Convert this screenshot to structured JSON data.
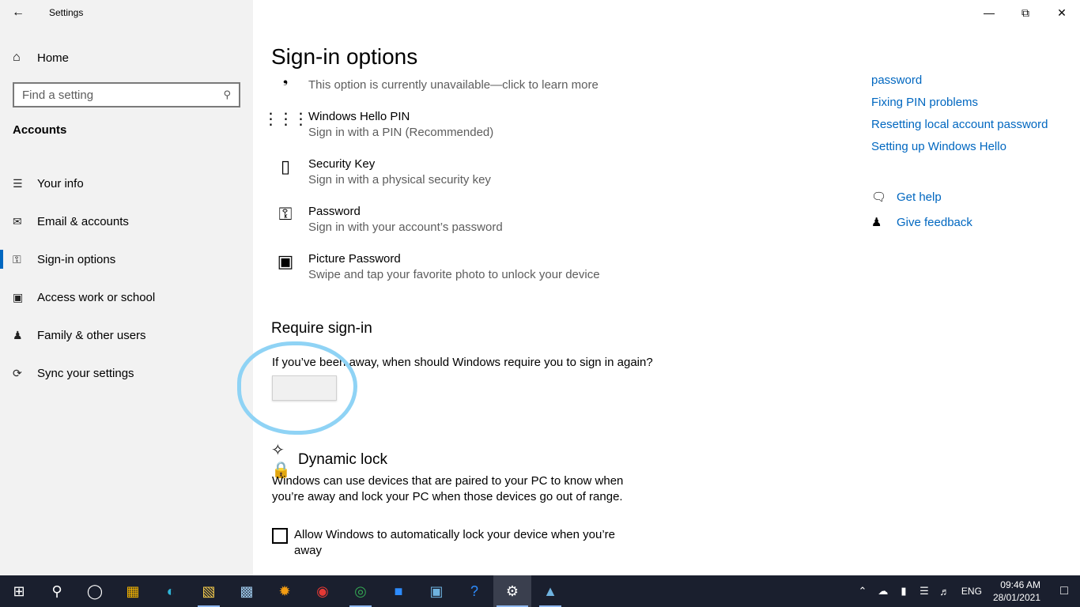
{
  "window": {
    "title": "Settings",
    "back_icon": "back-arrow-icon"
  },
  "sidebar": {
    "home_label": "Home",
    "search_placeholder": "Find a setting",
    "section": "Accounts",
    "items": [
      {
        "label": "Your info",
        "icon": "person-list-icon",
        "active": false
      },
      {
        "label": "Email & accounts",
        "icon": "mail-icon",
        "active": false
      },
      {
        "label": "Sign-in options",
        "icon": "key-icon",
        "active": true
      },
      {
        "label": "Access work or school",
        "icon": "briefcase-icon",
        "active": false
      },
      {
        "label": "Family & other users",
        "icon": "person-add-icon",
        "active": false
      },
      {
        "label": "Sync your settings",
        "icon": "sync-icon",
        "active": false
      }
    ]
  },
  "main": {
    "title": "Sign-in options",
    "options": [
      {
        "title": "",
        "subtitle": "This option is currently unavailable—click to learn more",
        "icon": "fingerprint-icon"
      },
      {
        "title": "Windows Hello PIN",
        "subtitle": "Sign in with a PIN (Recommended)",
        "icon": "pin-keypad-icon"
      },
      {
        "title": "Security Key",
        "subtitle": "Sign in with a physical security key",
        "icon": "usb-key-icon"
      },
      {
        "title": "Password",
        "subtitle": "Sign in with your account’s password",
        "icon": "key-icon"
      },
      {
        "title": "Picture Password",
        "subtitle": "Swipe and tap your favorite photo to unlock your device",
        "icon": "picture-icon"
      }
    ],
    "require_signin": {
      "heading": "Require sign-in",
      "question": "If you’ve been away, when should Windows require you to sign in again?",
      "dropdown_value": ""
    },
    "dynamic_lock": {
      "heading": "Dynamic lock",
      "description": "Windows can use devices that are paired to your PC to know when you’re away and lock your PC when those devices go out of range.",
      "checkbox_label": "Allow Windows to automatically lock your device when you’re away",
      "checked": false
    }
  },
  "related": {
    "links": [
      "password",
      "Fixing PIN problems",
      "Resetting local account password",
      "Setting up Windows Hello"
    ],
    "get_help": "Get help",
    "give_feedback": "Give feedback"
  },
  "taskbar": {
    "icons": [
      "windows-start-icon",
      "search-icon",
      "cortana-icon",
      "store-icon",
      "edge-icon",
      "file-explorer-icon",
      "photos-app-icon",
      "sunflower-app-icon",
      "red-app-icon",
      "chrome-icon",
      "zoom-icon",
      "control-panel-icon",
      "help-icon",
      "settings-icon",
      "photos-icon"
    ],
    "language": "ENG",
    "time": "09:46 AM",
    "date": "28/01/2021"
  },
  "colors": {
    "accent": "#0067c0",
    "sidebar_bg": "#f2f2f2",
    "taskbar_bg": "#1a1f2e",
    "annotation": "#8fd3f5"
  }
}
